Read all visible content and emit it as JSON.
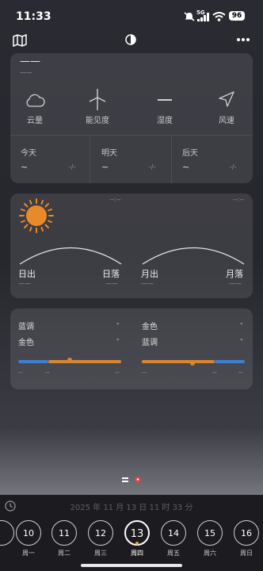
{
  "status_bar": {
    "time": "11:33",
    "signal": "5G",
    "battery": "96"
  },
  "toolbar": {
    "map_icon": "map-icon",
    "theme_icon": "half-circle-icon",
    "more_icon": "more-dots-icon"
  },
  "conditions": {
    "title": "——",
    "subtitle": "——",
    "items": [
      {
        "icon": "cloud-icon",
        "label": "云量"
      },
      {
        "icon": "wind-turbine-icon",
        "label": "能见度"
      },
      {
        "icon": "dash-icon",
        "label": "湿度"
      },
      {
        "icon": "navigation-arrow-icon",
        "label": "风速"
      }
    ],
    "days": [
      {
        "label": "今天",
        "value": "~",
        "range": "-/-"
      },
      {
        "label": "明天",
        "value": "~",
        "range": "-/-"
      },
      {
        "label": "后天",
        "value": "~",
        "range": "-/-"
      }
    ]
  },
  "sun_moon": {
    "sun_time": "--:--",
    "moon_time": "--:--",
    "sunrise": "日出",
    "sunset": "日落",
    "moonrise": "月出",
    "moonset": "月落",
    "placeholder": "——"
  },
  "golden": {
    "left": [
      {
        "label": "蓝调",
        "value": "-"
      },
      {
        "label": "金色",
        "value": "-"
      }
    ],
    "right": [
      {
        "label": "金色",
        "value": "-"
      },
      {
        "label": "蓝调",
        "value": "-"
      }
    ],
    "left_ticks": [
      "--",
      "--",
      "--"
    ],
    "right_ticks": [
      "--",
      "--",
      "--"
    ]
  },
  "footer": {
    "datetime": "2025 年 11 月 13 日 11 时 33 分",
    "dates": [
      {
        "num": "10",
        "weekday": "周一"
      },
      {
        "num": "11",
        "weekday": "周二"
      },
      {
        "num": "12",
        "weekday": "周三"
      },
      {
        "num": "13",
        "weekday": "周四"
      },
      {
        "num": "14",
        "weekday": "周五"
      },
      {
        "num": "15",
        "weekday": "周六"
      },
      {
        "num": "16",
        "weekday": "周日"
      }
    ]
  },
  "colors": {
    "sun": "#e8892a",
    "blue": "#3d7fd0",
    "gold": "#d98532"
  }
}
